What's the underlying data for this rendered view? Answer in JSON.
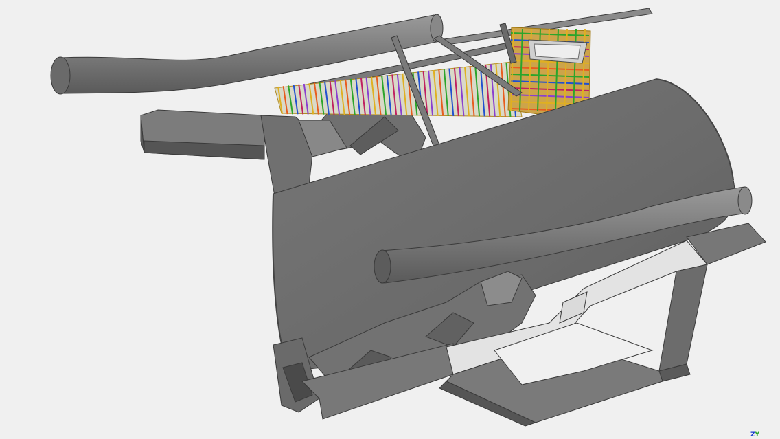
{
  "viewport": {
    "background": "#f0f0f0",
    "model_colors": {
      "solid": "#6e6e6e",
      "solid_light": "#8c8c8c",
      "solid_dark": "#4f4f4f",
      "edge": "#3a3a3a",
      "selected_face": "#e3e3e3",
      "rebar": [
        "#e0b020",
        "#e85c1e",
        "#2ba52b",
        "#2050d0",
        "#c02060",
        "#8a3fd0"
      ]
    }
  },
  "axis_gizmo": {
    "z_label": "Z",
    "y_label": "Y",
    "z_color": "#1a3bd0",
    "y_color": "#2aa52a"
  }
}
